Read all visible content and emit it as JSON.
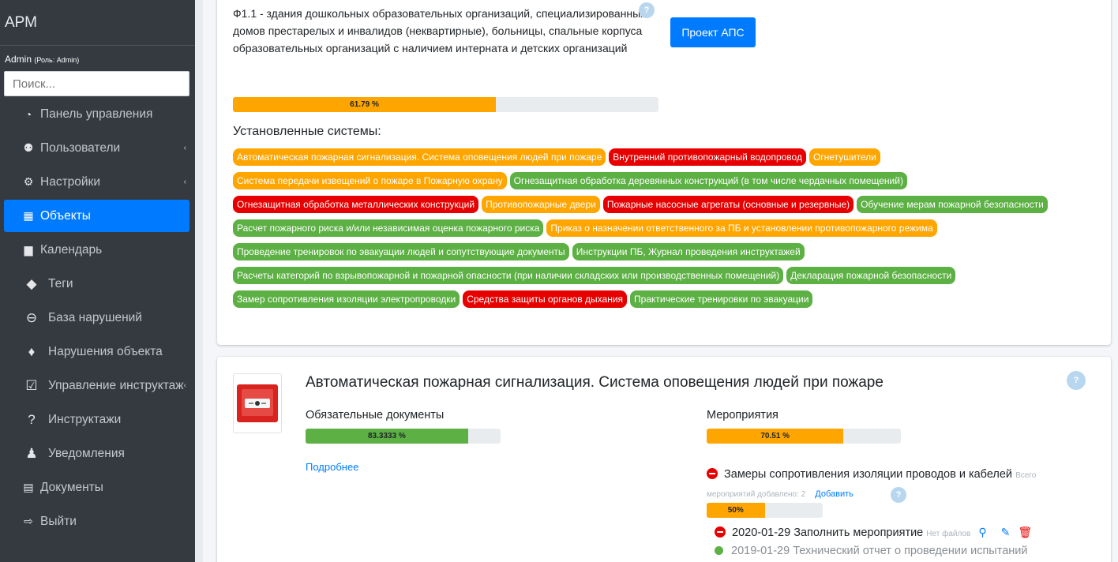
{
  "sidebar": {
    "brand": "АРМ",
    "user_name": "Admin",
    "user_role": "(Роль: Admin)",
    "search_placeholder": "Поиск...",
    "items": [
      {
        "label": "Панель управления",
        "icon": "tachometer-icon"
      },
      {
        "label": "Пользователи",
        "icon": "users-icon"
      },
      {
        "label": "Настройки",
        "icon": "cogs-icon"
      },
      {
        "label": "Объекты",
        "icon": "building-icon"
      },
      {
        "label": "Календарь",
        "icon": "calendar-icon"
      },
      {
        "label": "Теги",
        "icon": "tags-icon"
      },
      {
        "label": "База нарушений",
        "icon": "minus-circle-icon"
      },
      {
        "label": "Нарушения объекта",
        "icon": "fire-icon"
      },
      {
        "label": "Управление инструктажами",
        "icon": "check-square-icon"
      },
      {
        "label": "Инструктажи",
        "icon": "question-circle-icon"
      },
      {
        "label": "Уведомления",
        "icon": "bell-icon"
      },
      {
        "label": "Документы",
        "icon": "file-icon"
      },
      {
        "label": "Выйти",
        "icon": "sign-out-icon"
      }
    ]
  },
  "object": {
    "description": "Ф1.1 - здания дошкольных образовательных организаций, специализированных домов престарелых и инвалидов (неквартирные), больницы, спальные корпуса образовательных организаций с наличием интерната и детских организаций",
    "project_button": "Проект АПС",
    "progress_label": "61.79 %",
    "progress_value": 61.79,
    "systems_title": "Установленные системы:",
    "systems": [
      [
        {
          "label": "Автоматическая пожарная сигнализация. Система оповещения людей при пожаре",
          "status": "orange"
        },
        {
          "label": "Внутренний противопожарный водопровод",
          "status": "red"
        },
        {
          "label": "Огнетушители",
          "status": "orange"
        }
      ],
      [
        {
          "label": "Система передачи извещений о пожаре в Пожарную охрану",
          "status": "orange"
        },
        {
          "label": "Огнезащитная обработка деревянных конструкций (в том числе чердачных помещений)",
          "status": "green"
        }
      ],
      [
        {
          "label": "Огнезащитная обработка металлических конструкций",
          "status": "red"
        },
        {
          "label": "Противопожарные двери",
          "status": "orange"
        },
        {
          "label": "Пожарные насосные агрегаты (основные и резервные)",
          "status": "red"
        },
        {
          "label": "Обучение мерам пожарной безопасности",
          "status": "green"
        }
      ],
      [
        {
          "label": "Расчет пожарного риска и/или независимая оценка пожарного риска",
          "status": "green"
        },
        {
          "label": "Приказ о назначении ответственного за ПБ и установлении противопожарного режима",
          "status": "orange"
        }
      ],
      [
        {
          "label": "Проведение тренировок по эвакуации людей и сопутствующие документы",
          "status": "green"
        },
        {
          "label": "Инструкции ПБ, Журнал проведения инструктажей",
          "status": "green"
        }
      ],
      [
        {
          "label": "Расчеты категорий по взрывопожарной и пожарной опасности (при наличии складских или производственных помещений)",
          "status": "green"
        },
        {
          "label": "Декларация пожарной безопасности",
          "status": "green"
        }
      ],
      [
        {
          "label": "Замер сопротивления изоляции электропроводки",
          "status": "green"
        },
        {
          "label": "Средства защиты органов дыхания",
          "status": "red"
        },
        {
          "label": "Практические тренировки по эвакуации",
          "status": "green"
        }
      ]
    ]
  },
  "system_card": {
    "title": "Автоматическая пожарная сигнализация. Система оповещения людей при пожаре",
    "docs_title": "Обязательные документы",
    "docs_progress_label": "83.3333 %",
    "docs_progress_value": 83.3333,
    "more_link": "Подробнее",
    "events_title": "Мероприятия",
    "events_progress_label": "70.51 %",
    "events_progress_value": 70.51,
    "measure_title": "Замеры сопротивления изоляции проводов и кабелей",
    "measure_note": "Всего мероприятий добавлено: 2",
    "add_link": "Добавить",
    "measure_progress_label": "50%",
    "measure_progress_value": 50,
    "entries": [
      {
        "text": "2020-01-29 Заполнить мероприятие",
        "note": "Нет файлов",
        "status": "red"
      },
      {
        "text": "2019-01-29 Технический отчет о проведении испытаний",
        "note": "",
        "status": "green"
      }
    ]
  },
  "colors": {
    "sidebar_bg": "#343a40",
    "active": "#007bff",
    "orange": "#ffa500",
    "green": "#5cb044",
    "red": "#e60000"
  }
}
